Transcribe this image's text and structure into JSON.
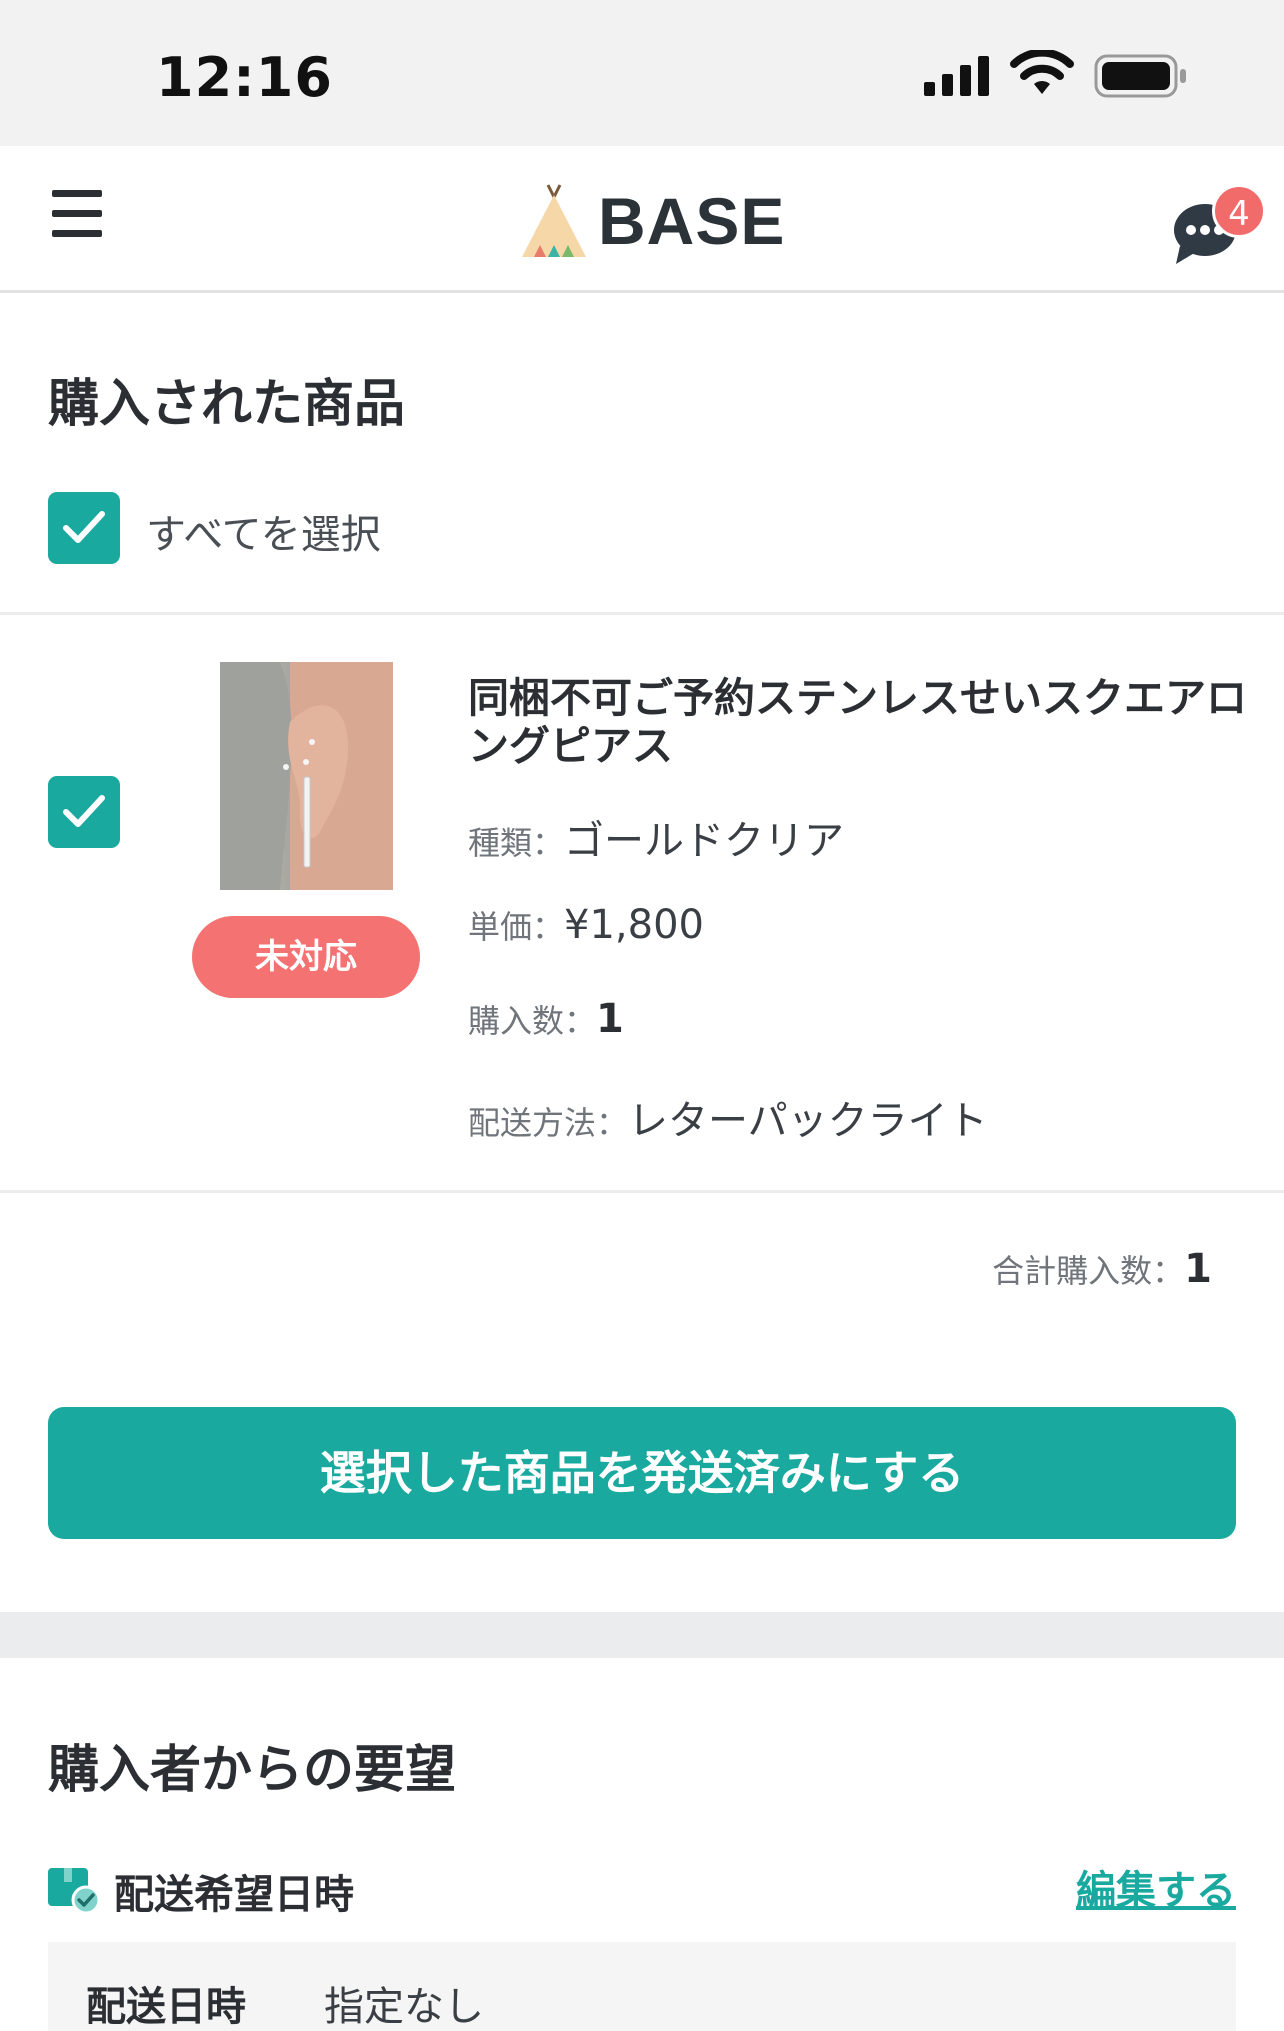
{
  "status_bar": {
    "time": "12:16"
  },
  "header": {
    "brand": "BASE",
    "chat_badge": "4"
  },
  "purchased": {
    "title": "購入された商品",
    "select_all": "すべてを選択",
    "item": {
      "name": "同梱不可ご予約ステンレスせいスクエアロングピアス",
      "status": "未対応",
      "type_label": "種類：",
      "type_value": "ゴールドクリア",
      "price_label": "単価：",
      "price_value": "¥1,800",
      "qty_label": "購入数：",
      "qty_value": "1",
      "ship_label": "配送方法：",
      "ship_value": "レターパックライト"
    },
    "total_label": "合計購入数：",
    "total_value": "1",
    "ship_button": "選択した商品を発送済みにする"
  },
  "request": {
    "title": "購入者からの要望",
    "delivery_heading": "配送希望日時",
    "edit": "編集する",
    "date_label": "配送日時",
    "date_value": "指定なし"
  },
  "colors": {
    "accent": "#1aa99f",
    "status_pill": "#f47272",
    "badge": "#f26b6b"
  }
}
